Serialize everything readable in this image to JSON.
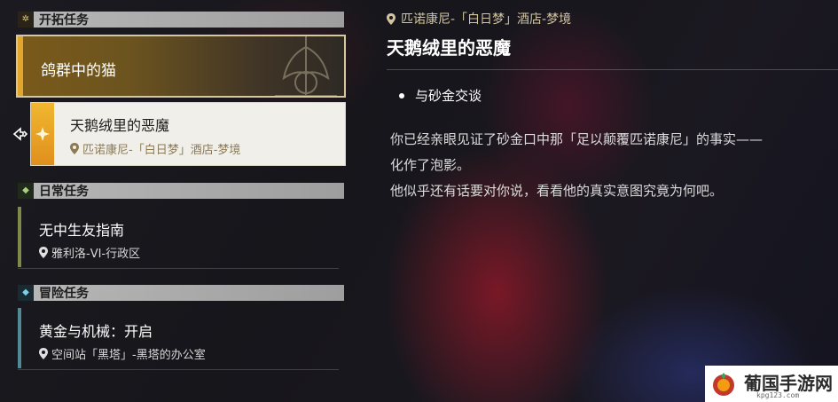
{
  "sections": {
    "trailblaze": {
      "label": "开拓任务"
    },
    "daily": {
      "label": "日常任务"
    },
    "adventure": {
      "label": "冒险任务"
    }
  },
  "quests": {
    "q1": {
      "title": "鸽群中的猫"
    },
    "q2": {
      "title": "天鹅绒里的恶魔",
      "location": "匹诺康尼-「白日梦」酒店-梦境"
    },
    "q3": {
      "title": "无中生友指南",
      "location": "雅利洛-VI-行政区"
    },
    "q4": {
      "title": "黄金与机械：开启",
      "location": "空间站「黑塔」-黑塔的办公室"
    }
  },
  "detail": {
    "location": "匹诺康尼-「白日梦」酒店-梦境",
    "title": "天鹅绒里的恶魔",
    "objective": "与砂金交谈",
    "description_line1": "你已经亲眼见证了砂金口中那「足以颠覆匹诺康尼」的事实——",
    "description_line2": "化作了泡影。",
    "description_line3": "他似乎还有话要对你说，看看他的真实意图究竟为何吧。"
  },
  "watermark": {
    "title": "葡国手游网",
    "url": "kpg123.com"
  },
  "colors": {
    "gold_accent": "#e2a62c",
    "daily_bar": "#7d8a4a",
    "adventure_bar": "#4f8a95",
    "location_gold": "#d2c4a0"
  },
  "icons": {
    "trailblaze": "trailblaze-icon",
    "daily": "daily-icon",
    "adventure": "adventure-icon",
    "location": "location-pin-icon",
    "selection": "selection-arrow-icon"
  }
}
